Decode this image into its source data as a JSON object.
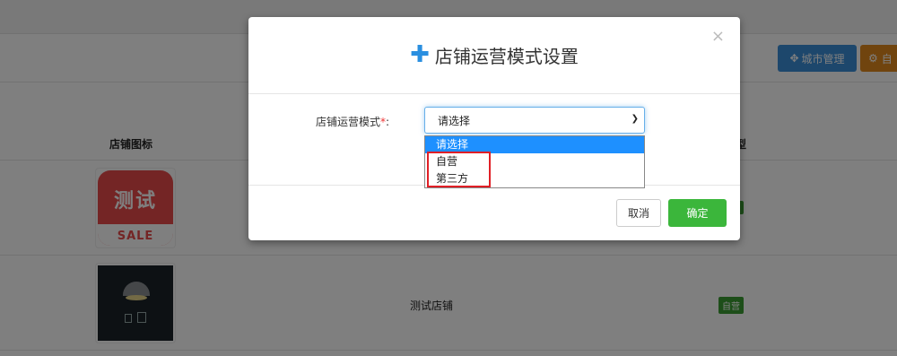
{
  "background": {
    "toolbar": {
      "city_button": {
        "icon": "move-icon",
        "label": "城市管理"
      },
      "auto_button": {
        "icon": "gear-icon",
        "label": "自"
      }
    },
    "table": {
      "headers": {
        "store_icon": "店铺图标",
        "type_partial": "类型"
      },
      "rows": [
        {
          "logo_text": "测试",
          "logo_sub": "SALE",
          "badge": ""
        },
        {
          "name": "测试店铺",
          "badge": "自营"
        }
      ]
    }
  },
  "modal": {
    "title_icon": "plus-icon",
    "title": "店铺运营模式设置",
    "close_label": "×",
    "field": {
      "label": "店铺运营模式",
      "required_mark": "*",
      "colon": ":",
      "selected_value": "请选择",
      "options": [
        "请选择",
        "自营",
        "第三方"
      ]
    },
    "buttons": {
      "cancel": "取消",
      "confirm": "确定"
    }
  },
  "colors": {
    "accent_blue": "#2a8fe0",
    "confirm_green": "#3bb63b",
    "highlight_red": "#e01f26",
    "selected_option": "#1e90ff"
  }
}
